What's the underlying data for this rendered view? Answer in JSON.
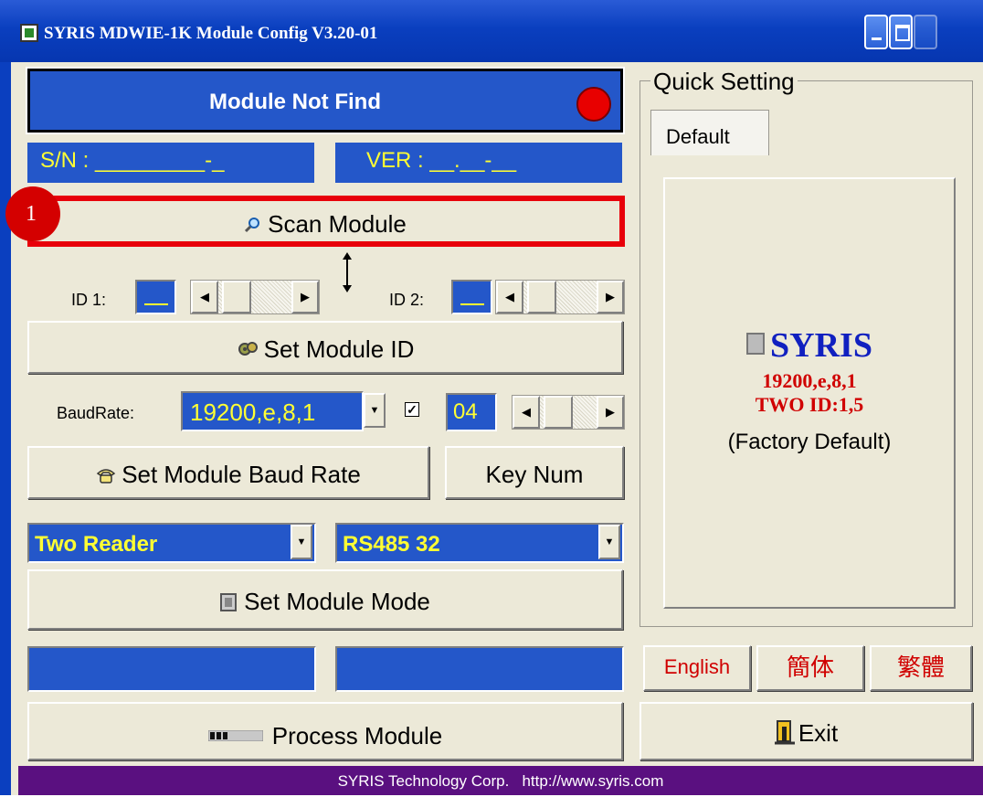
{
  "window": {
    "title": "SYRIS MDWIE-1K Module Config V3.20-01"
  },
  "status": {
    "text": "Module Not Find",
    "indicator_color": "#e80000"
  },
  "module_info": {
    "sn_text": "S/N : _________-_",
    "ver_text": "VER : __.__-__"
  },
  "scan": {
    "label": "Scan Module",
    "step_badge": "1",
    "highlight_color": "#e8000a"
  },
  "id_setting": {
    "id1_label": "ID 1:",
    "id2_label": "ID 2:",
    "swap_icon": "up-down-arrow-icon",
    "set_label": "Set Module ID"
  },
  "baud": {
    "label": "BaudRate:",
    "value": "19200,e,8,1",
    "checkbox_checked": true,
    "key_value": "04",
    "set_label": "Set Module Baud Rate",
    "keynum_label": "Key Num"
  },
  "mode": {
    "reader_mode": "Two Reader",
    "bus_mode": "RS485 32",
    "set_label": "Set Module Mode"
  },
  "process": {
    "label": "Process Module"
  },
  "quick_setting": {
    "title": "Quick Setting",
    "tab": "Default",
    "preset": {
      "brand": "SYRIS",
      "baud": "19200,e,8,1",
      "ids": "TWO ID:1,5",
      "caption": "(Factory Default)"
    }
  },
  "language": {
    "english": "English",
    "simplified": "簡体",
    "traditional": "繁體"
  },
  "exit": {
    "label": "Exit"
  },
  "footer": {
    "text": "SYRIS Technology Corp.   http://www.syris.com"
  },
  "colors": {
    "field_blue": "#2457c9",
    "field_text": "#ffff33",
    "window_bg": "#ece9d8",
    "footer_bg": "#5a1080"
  }
}
